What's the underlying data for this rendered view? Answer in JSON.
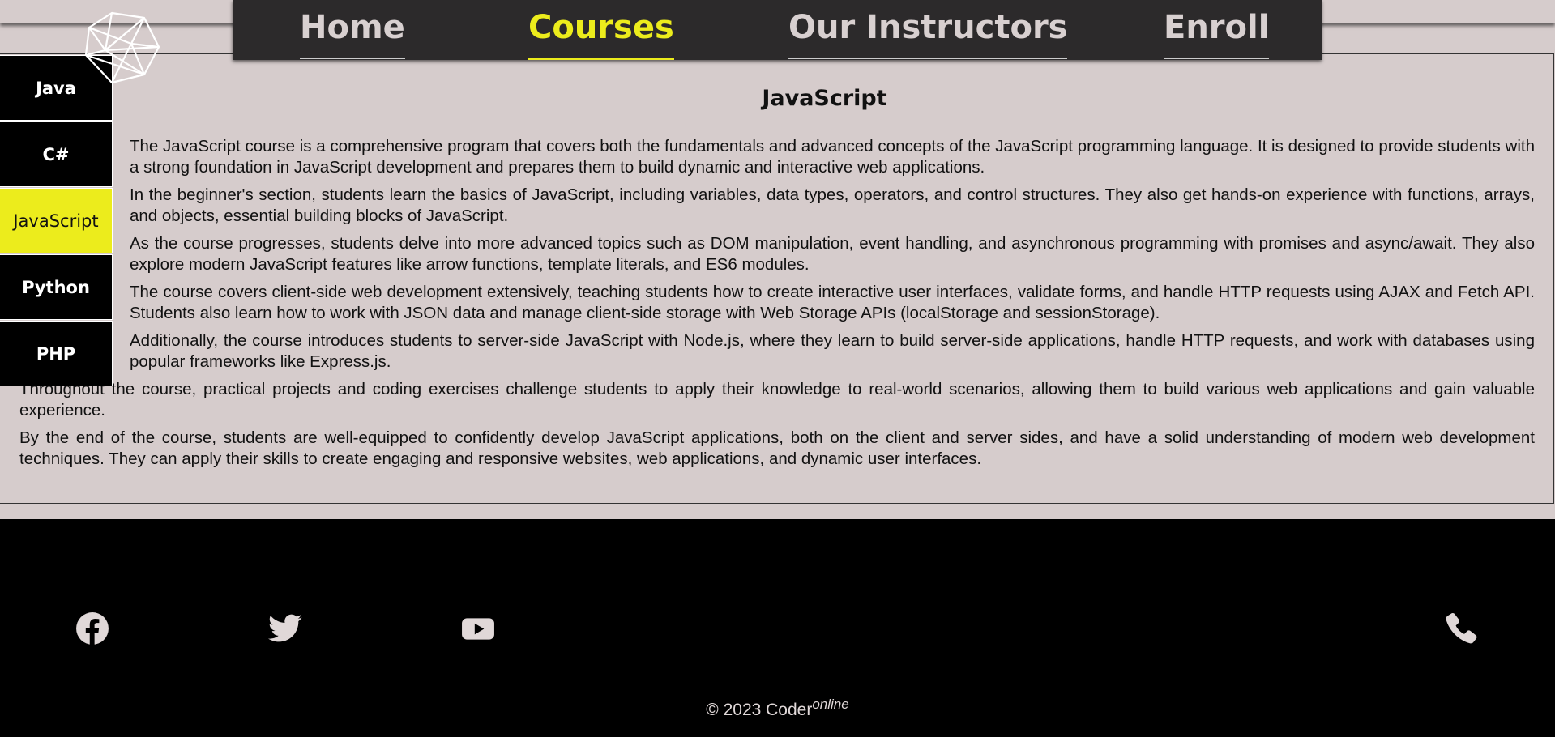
{
  "nav": {
    "items": [
      {
        "label": "Home"
      },
      {
        "label": "Courses"
      },
      {
        "label": "Our Instructors"
      },
      {
        "label": "Enroll"
      }
    ],
    "active": "Courses"
  },
  "sidebar": {
    "items": [
      {
        "label": "Java"
      },
      {
        "label": "C#"
      },
      {
        "label": "JavaScript"
      },
      {
        "label": "Python"
      },
      {
        "label": "PHP"
      }
    ],
    "active": "JavaScript"
  },
  "course": {
    "title": "JavaScript",
    "paragraphs": [
      "The JavaScript course is a comprehensive program that covers both the fundamentals and advanced concepts of the JavaScript programming language. It is designed to provide students with a strong foundation in JavaScript development and prepares them to build dynamic and interactive web applications.",
      "In the beginner's section, students learn the basics of JavaScript, including variables, data types, operators, and control structures. They also get hands-on experience with functions, arrays, and objects, essential building blocks of JavaScript.",
      "As the course progresses, students delve into more advanced topics such as DOM manipulation, event handling, and asynchronous programming with promises and async/await. They also explore modern JavaScript features like arrow functions, template literals, and ES6 modules.",
      "The course covers client-side web development extensively, teaching students how to create interactive user interfaces, validate forms, and handle HTTP requests using AJAX and Fetch API. Students also learn how to work with JSON data and manage client-side storage with Web Storage APIs (localStorage and sessionStorage).",
      "Additionally, the course introduces students to server-side JavaScript with Node.js, where they learn to build server-side applications, handle HTTP requests, and work with databases using popular frameworks like Express.js.",
      "Throughout the course, practical projects and coding exercises challenge students to apply their knowledge to real-world scenarios, allowing them to build various web applications and gain valuable experience.",
      "By the end of the course, students are well-equipped to confidently develop JavaScript applications, both on the client and server sides, and have a solid understanding of modern web development techniques. They can apply their skills to create engaging and responsive websites, web applications, and dynamic user interfaces."
    ]
  },
  "footer": {
    "social": [
      "facebook-icon",
      "twitter-icon",
      "youtube-icon",
      "phone-icon"
    ],
    "copyright": "© 2023 Coder",
    "copyright_sup": "online"
  },
  "colors": {
    "accent": "#ecec1c",
    "nav_bg": "#2c2a2b",
    "page_bg": "#d6cccc",
    "footer_bg": "#000000"
  }
}
